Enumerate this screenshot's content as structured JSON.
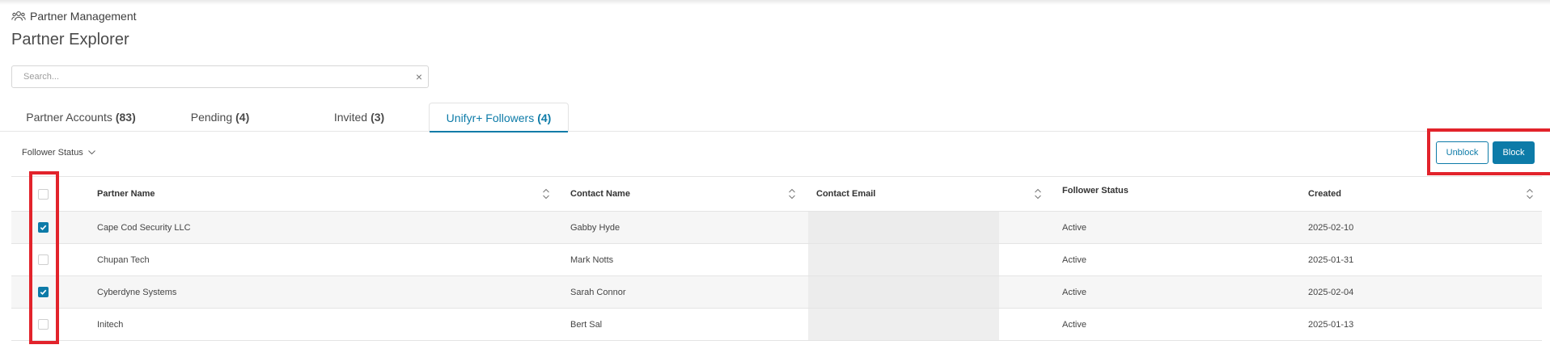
{
  "breadcrumb": {
    "label": "Partner Management",
    "icon": "partners-icon"
  },
  "page": {
    "title": "Partner Explorer"
  },
  "search": {
    "placeholder": "Search...",
    "value": "",
    "clear_glyph": "×"
  },
  "tabs": [
    {
      "label": "Partner Accounts",
      "count": "(83)",
      "active": false
    },
    {
      "label": "Pending",
      "count": "(4)",
      "active": false
    },
    {
      "label": "Invited",
      "count": "(3)",
      "active": false
    },
    {
      "label": "Unifyr+ Followers",
      "count": "(4)",
      "active": true
    }
  ],
  "filter": {
    "label": "Follower Status"
  },
  "actions": {
    "unblock_label": "Unblock",
    "block_label": "Block"
  },
  "table": {
    "columns": [
      "Partner Name",
      "Contact Name",
      "Contact Email",
      "Follower Status",
      "Created"
    ],
    "rows": [
      {
        "checked": true,
        "partner": "Cape Cod Security LLC",
        "contact": "Gabby Hyde",
        "email": "",
        "status": "Active",
        "created": "2025-02-10"
      },
      {
        "checked": false,
        "partner": "Chupan Tech",
        "contact": "Mark Notts",
        "email": "",
        "status": "Active",
        "created": "2025-01-31"
      },
      {
        "checked": true,
        "partner": "Cyberdyne Systems",
        "contact": "Sarah Connor",
        "email": "",
        "status": "Active",
        "created": "2025-02-04"
      },
      {
        "checked": false,
        "partner": "Initech",
        "contact": "Bert Sal",
        "email": "",
        "status": "Active",
        "created": "2025-01-13"
      }
    ]
  },
  "colors": {
    "accent": "#0d7ba8",
    "highlight": "#e2232b",
    "row_alt": "#f6f6f6"
  }
}
